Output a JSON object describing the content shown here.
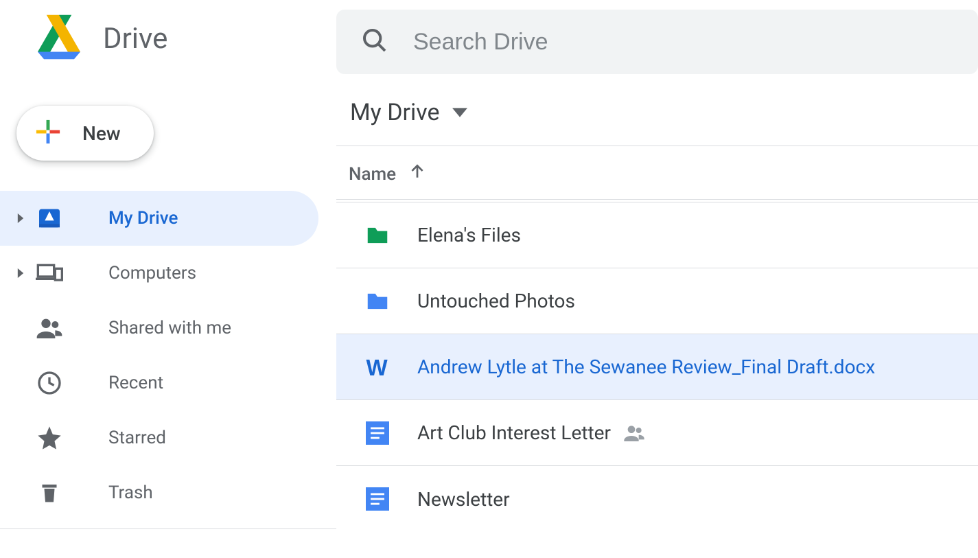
{
  "app_name": "Drive",
  "new_button_label": "New",
  "search_placeholder": "Search Drive",
  "breadcrumb_title": "My Drive",
  "column_header": "Name",
  "sidebar": {
    "items": [
      {
        "label": "My Drive",
        "icon": "drive-icon",
        "selected": true,
        "expandable": true
      },
      {
        "label": "Computers",
        "icon": "computers-icon",
        "selected": false,
        "expandable": true
      },
      {
        "label": "Shared with me",
        "icon": "shared-icon",
        "selected": false,
        "expandable": false
      },
      {
        "label": "Recent",
        "icon": "recent-icon",
        "selected": false,
        "expandable": false
      },
      {
        "label": "Starred",
        "icon": "starred-icon",
        "selected": false,
        "expandable": false
      },
      {
        "label": "Trash",
        "icon": "trash-icon",
        "selected": false,
        "expandable": false
      }
    ]
  },
  "files": [
    {
      "name": "Elena's Files",
      "type": "folder",
      "icon": "folder-green",
      "selected": false,
      "shared": false
    },
    {
      "name": "Untouched Photos",
      "type": "folder",
      "icon": "folder-blue",
      "selected": false,
      "shared": false
    },
    {
      "name": "Andrew Lytle at The Sewanee Review_Final Draft.docx",
      "type": "docx",
      "icon": "word-icon",
      "selected": true,
      "shared": false
    },
    {
      "name": "Art Club Interest Letter",
      "type": "gdoc",
      "icon": "gdoc-icon",
      "selected": false,
      "shared": true
    },
    {
      "name": "Newsletter",
      "type": "gdoc",
      "icon": "gdoc-icon",
      "selected": false,
      "shared": false
    }
  ]
}
